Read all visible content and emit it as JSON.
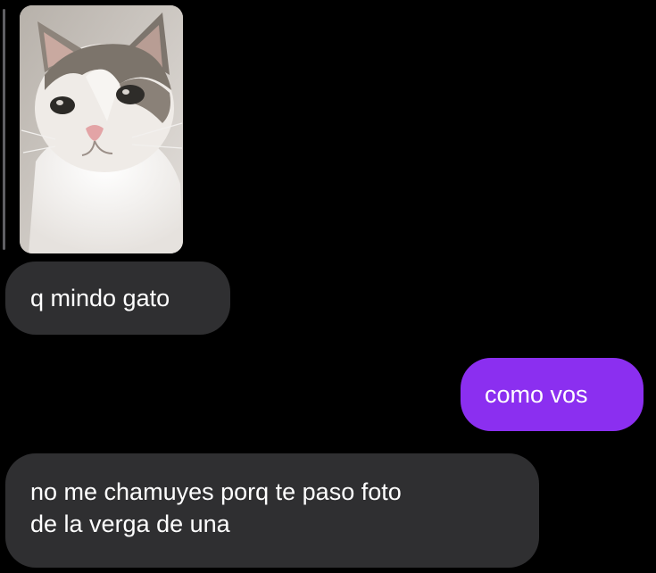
{
  "conversation": {
    "photo_message": {
      "icon": "cat-photo"
    },
    "messages": [
      {
        "direction": "incoming",
        "lines": [
          "q mindo gato"
        ]
      },
      {
        "direction": "outgoing",
        "lines": [
          "como vos"
        ]
      },
      {
        "direction": "incoming",
        "lines": [
          "no me chamuyes porq te paso foto",
          "de la verga de una"
        ]
      }
    ]
  },
  "colors": {
    "background": "#000000",
    "incoming_bubble": "#2f2f31",
    "outgoing_bubble": "#8b2ff0",
    "text": "#ffffff"
  }
}
